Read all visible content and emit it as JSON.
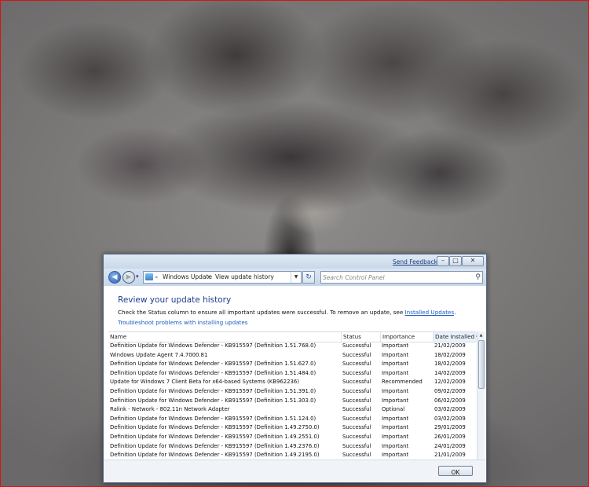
{
  "window": {
    "send_feedback": "Send Feedback",
    "controls": {
      "minimize": "–",
      "maximize": "□",
      "close": "✕"
    }
  },
  "navbar": {
    "address_lead": "«",
    "breadcrumbs": [
      "Windows Update",
      "View update history"
    ],
    "breadcrumb_separator": "▸",
    "search_placeholder": "Search Control Panel"
  },
  "content": {
    "heading": "Review your update history",
    "description_prefix": "Check the Status column to ensure all important updates were successful. To remove an update, see ",
    "installed_updates_link": "Installed Updates",
    "description_suffix": ".",
    "troubleshoot_link": "Troubleshoot problems with installing updates"
  },
  "table": {
    "columns": {
      "name": "Name",
      "status": "Status",
      "importance": "Importance",
      "date": "Date Installed"
    },
    "rows": [
      {
        "name": "Definition Update for Windows Defender - KB915597 (Definition 1.51.768.0)",
        "status": "Successful",
        "importance": "Important",
        "date": "21/02/2009"
      },
      {
        "name": "Windows Update Agent 7.4.7000.81",
        "status": "Successful",
        "importance": "Important",
        "date": "18/02/2009"
      },
      {
        "name": "Definition Update for Windows Defender - KB915597 (Definition 1.51.627.0)",
        "status": "Successful",
        "importance": "Important",
        "date": "18/02/2009"
      },
      {
        "name": "Definition Update for Windows Defender - KB915597 (Definition 1.51.484.0)",
        "status": "Successful",
        "importance": "Important",
        "date": "14/02/2009"
      },
      {
        "name": "Update for Windows 7 Client Beta for x64-based Systems (KB962236)",
        "status": "Successful",
        "importance": "Recommended",
        "date": "12/02/2009"
      },
      {
        "name": "Definition Update for Windows Defender - KB915597 (Definition 1.51.391.0)",
        "status": "Successful",
        "importance": "Important",
        "date": "09/02/2009"
      },
      {
        "name": "Definition Update for Windows Defender - KB915597 (Definition 1.51.303.0)",
        "status": "Successful",
        "importance": "Important",
        "date": "06/02/2009"
      },
      {
        "name": "Ralink - Network - 802.11n Network Adapter",
        "status": "Successful",
        "importance": "Optional",
        "date": "03/02/2009"
      },
      {
        "name": "Definition Update for Windows Defender - KB915597 (Definition 1.51.124.0)",
        "status": "Successful",
        "importance": "Important",
        "date": "03/02/2009"
      },
      {
        "name": "Definition Update for Windows Defender - KB915597 (Definition 1.49.2750.0)",
        "status": "Successful",
        "importance": "Important",
        "date": "29/01/2009"
      },
      {
        "name": "Definition Update for Windows Defender - KB915597 (Definition 1.49.2551.0)",
        "status": "Successful",
        "importance": "Important",
        "date": "26/01/2009"
      },
      {
        "name": "Definition Update for Windows Defender - KB915597 (Definition 1.49.2376.0)",
        "status": "Successful",
        "importance": "Important",
        "date": "24/01/2009"
      },
      {
        "name": "Definition Update for Windows Defender - KB915597 (Definition 1.49.2195.0)",
        "status": "Successful",
        "importance": "Important",
        "date": "21/01/2009"
      }
    ]
  },
  "footer": {
    "ok_label": "OK"
  },
  "colors": {
    "heading": "#1e3c8f",
    "link": "#1a5bc4",
    "frame_border": "#dd1111"
  }
}
